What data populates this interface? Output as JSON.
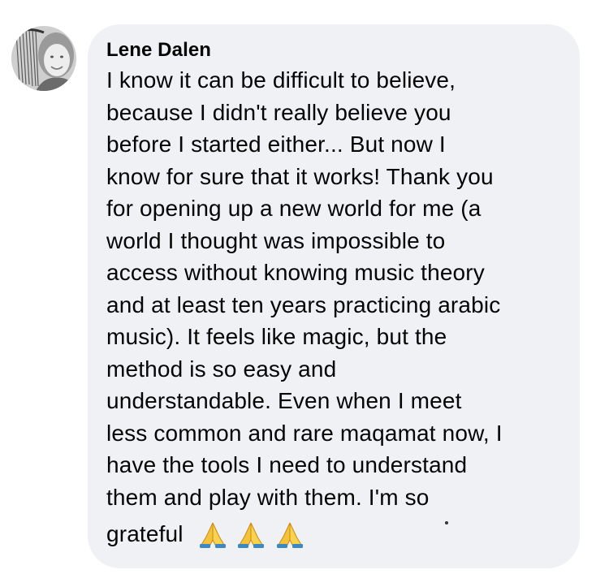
{
  "comment": {
    "author": "Lene Dalen",
    "lines": [
      "I know it can be difficult to believe,",
      "because I didn't really believe you",
      "before I started either... But now I",
      "know for sure that it works! Thank you",
      "for opening up a new world for me (a",
      "world I thought was impossible to",
      "access without knowing music theory",
      "and at least ten years practicing arabic",
      "music). It feels like magic, but the",
      "method is so easy and",
      "understandable. Even when I meet",
      "less common and rare maqamat now, I",
      "have the tools I need to understand",
      "them and play with them. I'm so"
    ],
    "last_line": "grateful",
    "emoji": [
      "folded-hands-icon",
      "folded-hands-icon",
      "folded-hands-icon"
    ]
  },
  "colors": {
    "bubble_bg": "#f0f1f5",
    "text": "#050505"
  }
}
